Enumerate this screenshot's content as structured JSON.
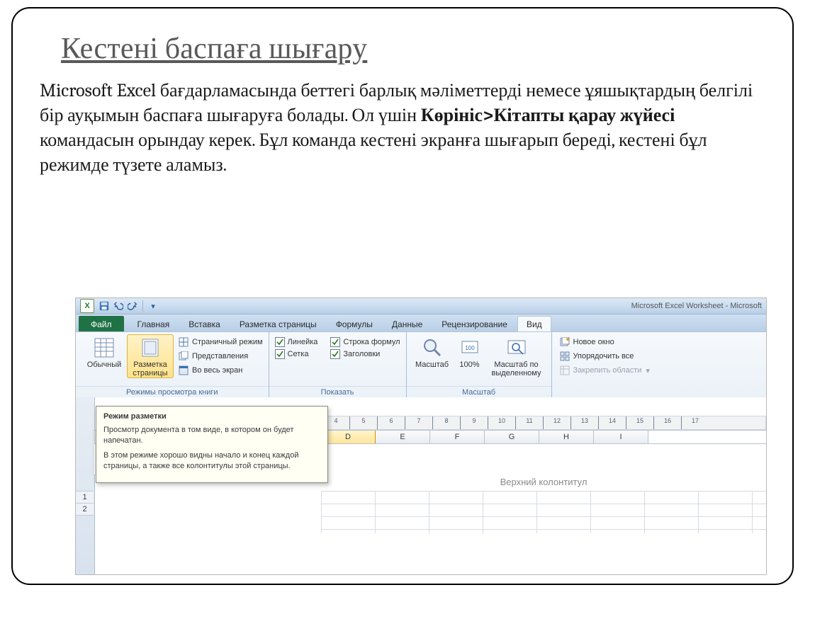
{
  "slide": {
    "title": "Кестені баспаға шығару",
    "para_pre": "Microsoft Excel бағдарламасында беттегі барлық мәліметтерді немесе ұяшықтардың белгілі бір ауқымын баспаға шығаруға болады. Ол үшін ",
    "para_bold": "Көрініс>Кітапты қарау жүйесі",
    "para_post": " командасын орындау керек. Бұл команда кестені экранға шығарып береді, кестені бұл режимде түзете аламыз."
  },
  "title_bar": {
    "excel_letter": "X",
    "window_title": "Microsoft Excel Worksheet - Microsoft"
  },
  "tabs": {
    "file": "Файл",
    "items": [
      "Главная",
      "Вставка",
      "Разметка страницы",
      "Формулы",
      "Данные",
      "Рецензирование"
    ],
    "active": "Вид"
  },
  "ribbon": {
    "views": {
      "normal": "Обычный",
      "page_layout": "Разметка страницы",
      "page_break": "Страничный режим",
      "custom_views": "Представления",
      "full_screen": "Во весь экран",
      "group_label": "Режимы просмотра книги"
    },
    "show": {
      "ruler": "Линейка",
      "grid": "Сетка",
      "formula_bar": "Строка формул",
      "headings": "Заголовки",
      "group_label": "Показать"
    },
    "zoom": {
      "zoom": "Масштаб",
      "hundred": "100%",
      "to_selection_l1": "Масштаб по",
      "to_selection_l2": "выделенному",
      "group_label": "Масштаб"
    },
    "window": {
      "new_window": "Новое окно",
      "arrange_all": "Упорядочить все",
      "freeze": "Закрепить области",
      "freeze_disabled": true
    }
  },
  "tooltip": {
    "title": "Режим разметки",
    "p1": "Просмотр документа в том виде, в котором он будет напечатан.",
    "p2": "В этом режиме хорошо видны начало и конец каждой страницы, а также все колонтитулы этой страницы."
  },
  "ruler_ticks": [
    "4",
    "5",
    "6",
    "7",
    "8",
    "9",
    "10",
    "11",
    "12",
    "13",
    "14",
    "15",
    "16",
    "17"
  ],
  "col_heads": [
    "D",
    "E",
    "F",
    "G",
    "H",
    "I"
  ],
  "selected_col": "D",
  "row_heads": [
    "1",
    "2"
  ],
  "header_placeholder": "Верхний колонтитул"
}
